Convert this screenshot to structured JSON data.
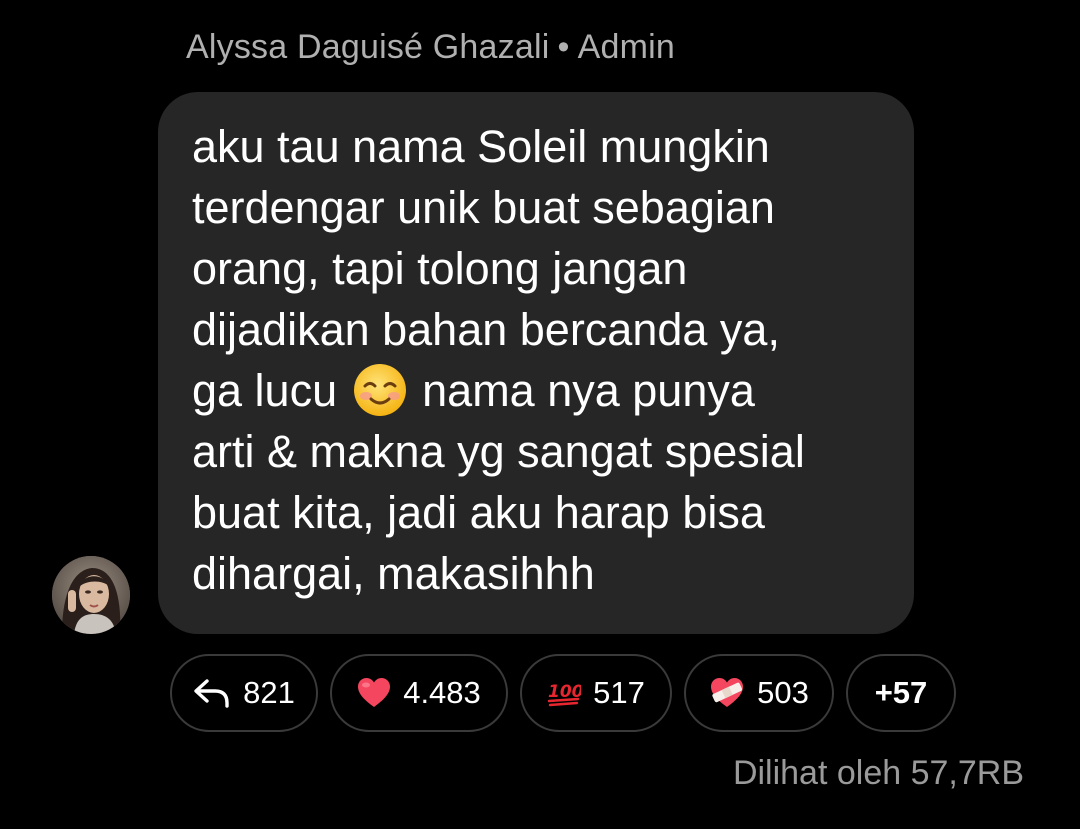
{
  "message": {
    "sender_name": "Alyssa Daguisé Ghazali",
    "separator": "•",
    "sender_role": "Admin",
    "avatar_icon": "profile-photo-avatar",
    "lines": [
      "aku tau nama Soleil mungkin",
      "terdengar unik buat sebagian",
      "orang, tapi tolong jangan",
      "dijadikan bahan bercanda ya,",
      "ga lucu",
      "nama nya punya",
      "arti & makna yg sangat spesial",
      "buat kita, jadi aku harap bisa",
      "dihargai, makasihhh"
    ],
    "inline_emoji": "smiling-face-emoji"
  },
  "reactions": {
    "reply": {
      "icon": "reply-arrow-icon",
      "count": "821"
    },
    "heart": {
      "icon": "red-heart-emoji",
      "count": "4.483"
    },
    "hundred": {
      "icon": "hundred-points-emoji",
      "count": "517"
    },
    "mended_heart": {
      "icon": "mending-heart-emoji",
      "count": "503"
    },
    "more": {
      "label": "+57"
    }
  },
  "footer": {
    "seen_by": "Dilihat oleh 57,7RB"
  },
  "colors": {
    "background": "#000000",
    "bubble": "#262626",
    "sender_text": "#b0b0b0",
    "muted_text": "#9a9a9a",
    "chip_border": "#3a3a3a"
  }
}
